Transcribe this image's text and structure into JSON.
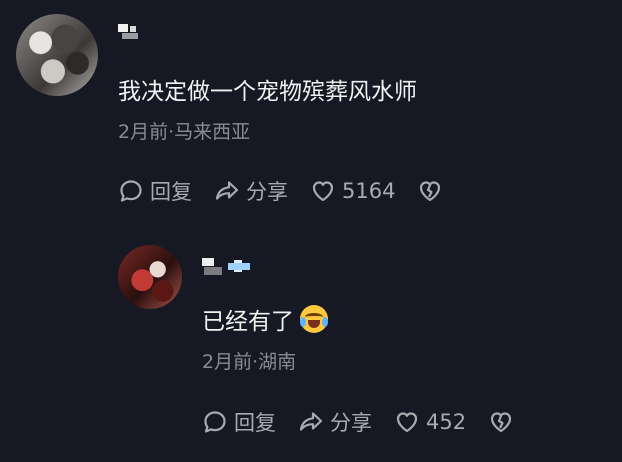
{
  "comments": [
    {
      "text": "我决定做一个宠物殡葬风水师",
      "meta": "2月前·马来西亚",
      "reply_label": "回复",
      "share_label": "分享",
      "likes": "5164"
    },
    {
      "text": "已经有了",
      "meta": "2月前·湖南",
      "reply_label": "回复",
      "share_label": "分享",
      "likes": "452"
    }
  ],
  "icons": [
    "comment-icon",
    "share-icon",
    "heart-icon",
    "broken-heart-icon",
    "crying-laughing-emoji"
  ],
  "colors": {
    "background": "#161823",
    "text": "#f1f1f2",
    "muted": "#8a8b91",
    "actions": "#a9aab0"
  }
}
